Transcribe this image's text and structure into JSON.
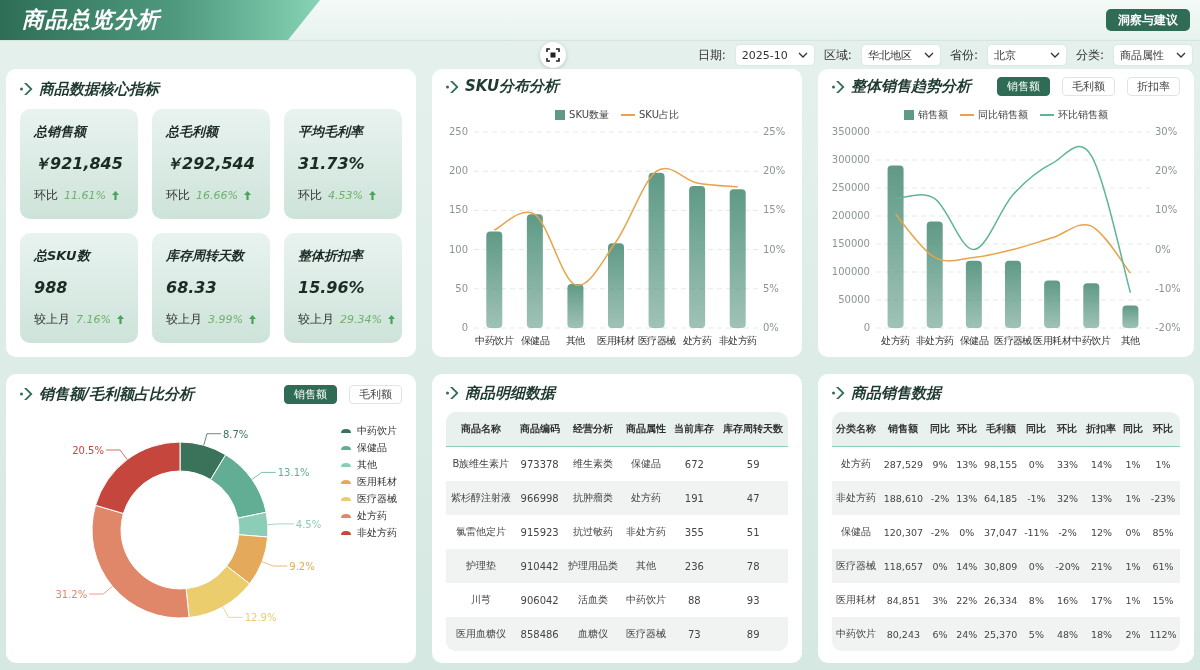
{
  "header": {
    "title": "商品总览分析",
    "action_button": "洞察与建议"
  },
  "filters": [
    {
      "label": "日期:",
      "value": "2025-10"
    },
    {
      "label": "区域:",
      "value": "华北地区"
    },
    {
      "label": "省份:",
      "value": "北京"
    },
    {
      "label": "分类:",
      "value": "商品属性"
    }
  ],
  "kpi_panel": {
    "title": "商品数据核心指标",
    "tiles": [
      {
        "title": "总销售额",
        "value": "￥921,845",
        "compare_label": "环比",
        "change": "11.61%"
      },
      {
        "title": "总毛利额",
        "value": "￥292,544",
        "compare_label": "环比",
        "change": "16.66%"
      },
      {
        "title": "平均毛利率",
        "value": "31.73%",
        "compare_label": "环比",
        "change": "4.53%"
      },
      {
        "title": "总SKU数",
        "value": "988",
        "compare_label": "较上月",
        "change": "7.16%"
      },
      {
        "title": "库存周转天数",
        "value": "68.33",
        "compare_label": "较上月",
        "change": "3.99%"
      },
      {
        "title": "整体折扣率",
        "value": "15.96%",
        "compare_label": "较上月",
        "change": "29.34%"
      }
    ]
  },
  "sku_panel": {
    "title": "SKU分布分析",
    "chart_data": {
      "type": "bar",
      "legend": "top",
      "grid": true,
      "categories": [
        "中药饮片",
        "保健品",
        "其他",
        "医用耗材",
        "医疗器械",
        "处方药",
        "非处方药"
      ],
      "series": [
        {
          "name": "SKU数量",
          "type": "bar",
          "color": "#5f9a86",
          "values": [
            123,
            145,
            56,
            108,
            198,
            181,
            177
          ]
        },
        {
          "name": "SKU占比",
          "type": "line",
          "axis": "y2",
          "color": "#e8a44c",
          "values": [
            12.5,
            14.5,
            5.5,
            11,
            20,
            18.5,
            18
          ]
        }
      ],
      "ylim": [
        0,
        250
      ],
      "yticks": [
        0,
        50,
        100,
        150,
        200,
        250
      ],
      "y2lim": [
        0,
        25
      ],
      "y2ticks": [
        {
          "value": 0,
          "label": "0%"
        },
        {
          "value": 5,
          "label": "5%"
        },
        {
          "value": 10,
          "label": "10%"
        },
        {
          "value": 15,
          "label": "15%"
        },
        {
          "value": 20,
          "label": "20%"
        },
        {
          "value": 25,
          "label": "25%"
        }
      ]
    }
  },
  "trend_panel": {
    "title": "整体销售趋势分析",
    "tabs": [
      {
        "label": "销售额",
        "selected": true
      },
      {
        "label": "毛利额",
        "selected": false
      },
      {
        "label": "折扣率",
        "selected": false
      }
    ],
    "chart_data": {
      "type": "bar",
      "legend": "top",
      "grid": true,
      "categories": [
        "处方药",
        "非处方药",
        "保健品",
        "医疗器械",
        "医用耗材",
        "中药饮片",
        "其他"
      ],
      "series": [
        {
          "name": "销售额",
          "type": "bar",
          "color": "#5f9a86",
          "values": [
            290000,
            190000,
            120000,
            120000,
            85000,
            80000,
            40000
          ]
        },
        {
          "name": "同比销售额",
          "type": "line",
          "axis": "y2",
          "color": "#e8a44c",
          "values": [
            9,
            -2,
            -2,
            0,
            3,
            6,
            -6
          ]
        },
        {
          "name": "环比销售额",
          "type": "line",
          "axis": "y2",
          "color": "#5fb595",
          "values": [
            13,
            13,
            0,
            14,
            22,
            24,
            -11
          ]
        }
      ],
      "ylim": [
        0,
        350000
      ],
      "yticks": [
        0,
        50000,
        100000,
        150000,
        200000,
        250000,
        300000,
        350000
      ],
      "y2lim": [
        -20,
        30
      ],
      "y2ticks": [
        {
          "value": -20,
          "label": "-20%"
        },
        {
          "value": -10,
          "label": "-10%"
        },
        {
          "value": 0,
          "label": "0%"
        },
        {
          "value": 10,
          "label": "10%"
        },
        {
          "value": 20,
          "label": "20%"
        },
        {
          "value": 30,
          "label": "30%"
        }
      ]
    }
  },
  "share_panel": {
    "title": "销售额/毛利额占比分析",
    "tabs": [
      {
        "label": "销售额",
        "selected": true
      },
      {
        "label": "毛利额",
        "selected": false
      }
    ],
    "chart_data": {
      "type": "donut",
      "legend": "right",
      "categories": [
        "中药饮片",
        "保健品",
        "其他",
        "医用耗材",
        "医疗器械",
        "处方药",
        "非处方药"
      ],
      "values": [
        8.7,
        13.1,
        4.5,
        9.2,
        12.9,
        31.2,
        20.5
      ],
      "colors": [
        "#3a7359",
        "#62ae95",
        "#8bcdb6",
        "#e4a95a",
        "#ebcd6e",
        "#e0876a",
        "#c4463c"
      ],
      "value_labels": [
        "8.7%",
        "13.1%",
        "4.5%",
        "9.2%",
        "12.9%",
        "31.2%",
        "20.5%"
      ]
    }
  },
  "detail_panel": {
    "title": "商品明细数据",
    "table": {
      "columns": [
        "商品名称",
        "商品编码",
        "经营分析",
        "商品属性",
        "当前库存",
        "库存周转天数"
      ],
      "rows": [
        [
          "B族维生素片",
          "973378",
          "维生素类",
          "保健品",
          "672",
          "59"
        ],
        [
          "紫杉醇注射液",
          "966998",
          "抗肿瘤类",
          "处方药",
          "191",
          "47"
        ],
        [
          "氯雷他定片",
          "915923",
          "抗过敏药",
          "非处方药",
          "355",
          "51"
        ],
        [
          "护理垫",
          "910442",
          "护理用品类",
          "其他",
          "236",
          "78"
        ],
        [
          "川芎",
          "906042",
          "活血类",
          "中药饮片",
          "88",
          "93"
        ],
        [
          "医用血糖仪",
          "858486",
          "血糖仪",
          "医疗器械",
          "73",
          "89"
        ]
      ]
    }
  },
  "sales_panel": {
    "title": "商品销售数据",
    "table": {
      "columns": [
        "分类名称",
        "销售额",
        "同比",
        "环比",
        "毛利额",
        "同比",
        "环比",
        "折扣率",
        "同比",
        "环比"
      ],
      "rows": [
        [
          "处方药",
          "287,529",
          "9%",
          "13%",
          "98,155",
          "0%",
          "33%",
          "14%",
          "1%",
          "1%"
        ],
        [
          "非处方药",
          "188,610",
          "-2%",
          "13%",
          "64,185",
          "-1%",
          "32%",
          "13%",
          "1%",
          "-23%"
        ],
        [
          "保健品",
          "120,307",
          "-2%",
          "0%",
          "37,047",
          "-11%",
          "-2%",
          "12%",
          "0%",
          "85%"
        ],
        [
          "医疗器械",
          "118,657",
          "0%",
          "14%",
          "30,809",
          "0%",
          "-20%",
          "21%",
          "1%",
          "61%"
        ],
        [
          "医用耗材",
          "84,851",
          "3%",
          "22%",
          "26,334",
          "8%",
          "16%",
          "17%",
          "1%",
          "15%"
        ],
        [
          "中药饮片",
          "80,243",
          "6%",
          "24%",
          "25,370",
          "5%",
          "48%",
          "18%",
          "2%",
          "112%"
        ]
      ]
    }
  }
}
